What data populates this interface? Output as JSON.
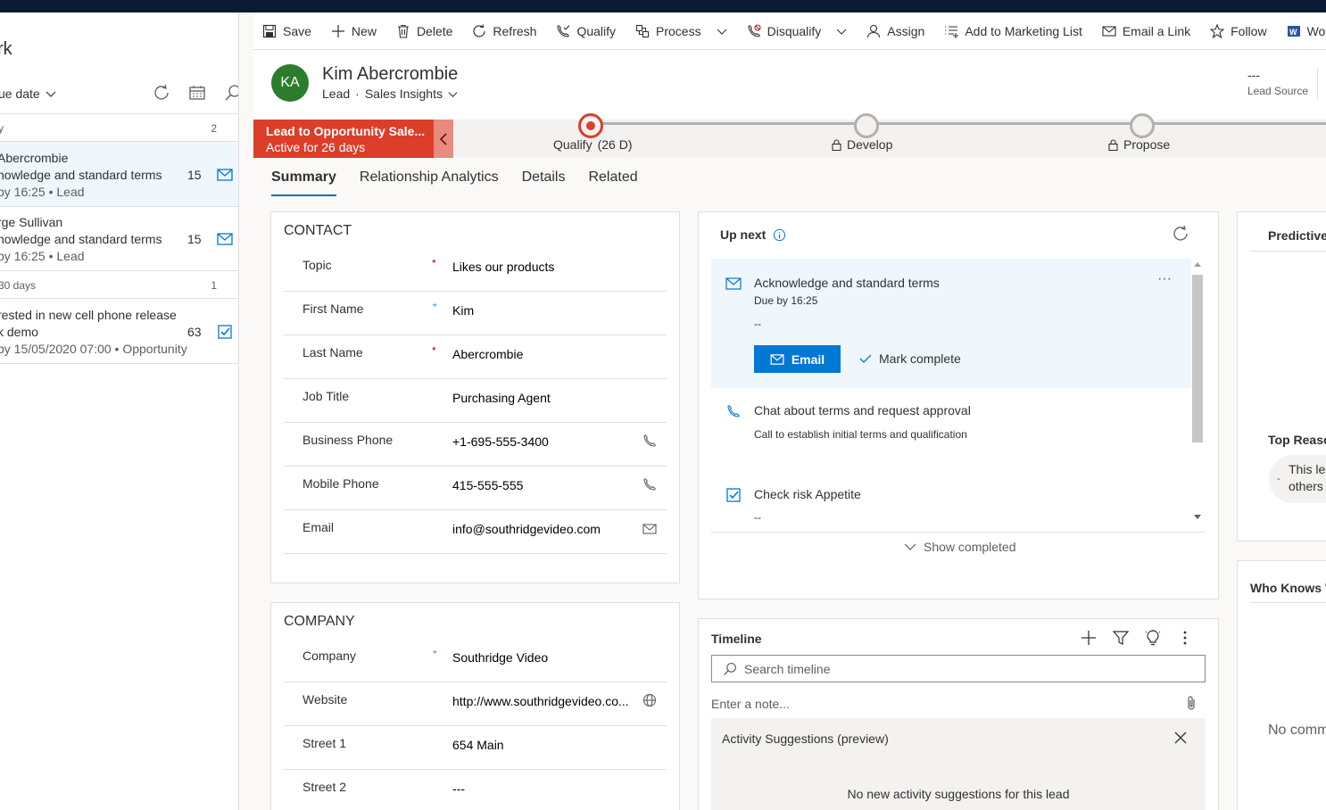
{
  "worklist": {
    "title": "rk",
    "sort_label": "ue date",
    "groups": [
      {
        "label": "y",
        "count": "2"
      },
      {
        "label": "30 days",
        "count": "1"
      }
    ],
    "items": [
      {
        "line1": "Abercrombie",
        "line2": "nowledge and standard terms",
        "line3": "by 16:25 • Lead",
        "count": "15",
        "icon": "mail-icon"
      },
      {
        "line1": "rge Sullivan",
        "line2": "nowledge and standard terms",
        "line3": "by 16:25 • Lead",
        "count": "15",
        "icon": "mail-icon"
      },
      {
        "line1": "rested in new cell phone release",
        "line2": "k demo",
        "line3": "by 15/05/2020 07:00 • Opportunity",
        "count": "63",
        "icon": "task-check-icon"
      }
    ]
  },
  "commands": [
    {
      "label": "Save",
      "icon": "save-icon"
    },
    {
      "label": "New",
      "icon": "plus-icon"
    },
    {
      "label": "Delete",
      "icon": "trash-icon"
    },
    {
      "label": "Refresh",
      "icon": "refresh-icon"
    },
    {
      "label": "Qualify",
      "icon": "phone-check-icon"
    },
    {
      "label": "Process",
      "icon": "process-icon"
    },
    {
      "label": "Disqualify",
      "icon": "disqualify-icon"
    },
    {
      "label": "Assign",
      "icon": "person-icon"
    },
    {
      "label": "Add to Marketing List",
      "icon": "list-add-icon"
    },
    {
      "label": "Email a Link",
      "icon": "email-link-icon"
    },
    {
      "label": "Follow",
      "icon": "star-icon"
    },
    {
      "label": "Wo",
      "icon": "word-icon"
    }
  ],
  "record": {
    "initials": "KA",
    "name": "Kim Abercrombie",
    "entity": "Lead",
    "dot": "·",
    "form": "Sales Insights",
    "lead_source_value": "---",
    "lead_source_label": "Lead Source",
    "avatar_color": "#2b7d2b"
  },
  "process": {
    "name": "Lead to Opportunity Sale...",
    "active": "Active for 26 days",
    "stages": [
      {
        "label": "Qualify",
        "duration": "(26 D)"
      },
      {
        "label": "Develop"
      },
      {
        "label": "Propose"
      }
    ],
    "accent": "#dc3e2a"
  },
  "tabs": [
    "Summary",
    "Relationship Analytics",
    "Details",
    "Related"
  ],
  "contact": {
    "heading": "CONTACT",
    "fields": [
      {
        "label": "Topic",
        "req": "*",
        "value": "Likes our products"
      },
      {
        "label": "First Name",
        "req": "⁺",
        "value": "Kim"
      },
      {
        "label": "Last Name",
        "req": "*",
        "value": "Abercrombie"
      },
      {
        "label": "Job Title",
        "req": "",
        "value": "Purchasing Agent"
      },
      {
        "label": "Business Phone",
        "req": "",
        "value": "+1-695-555-3400"
      },
      {
        "label": "Mobile Phone",
        "req": "",
        "value": "415-555-555"
      },
      {
        "label": "Email",
        "req": "",
        "value": "info@southridgevideo.com"
      }
    ]
  },
  "company": {
    "heading": "COMPANY",
    "fields": [
      {
        "label": "Company",
        "req": "⁺",
        "value": "Southridge Video"
      },
      {
        "label": "Website",
        "req": "",
        "value": "http://www.southridgevideo.co..."
      },
      {
        "label": "Street 1",
        "req": "",
        "value": "654 Main"
      },
      {
        "label": "Street 2",
        "req": "",
        "value": "---"
      }
    ]
  },
  "upnext": {
    "title": "Up next",
    "more": "···",
    "activities": [
      {
        "title": "Acknowledge and standard terms",
        "sub": "Due by 16:25",
        "desc": "--"
      },
      {
        "title": "Chat about terms and request approval",
        "sub": "Call to establish initial terms and qualification"
      },
      {
        "title": "Check risk Appetite",
        "sub": "--"
      }
    ],
    "email_button": "Email",
    "complete_button": "Mark complete",
    "show_completed": "Show completed"
  },
  "timeline": {
    "title": "Timeline",
    "search_placeholder": "Search timeline",
    "note_placeholder": "Enter a note...",
    "suggestions_title": "Activity Suggestions (preview)",
    "suggestions_empty": "No new activity suggestions for this lead"
  },
  "predictive": {
    "title": "Predictive",
    "top_reasons": "Top Reaso",
    "reason_dash": "-",
    "reason_line1": "This lea",
    "reason_line2": "others"
  },
  "whoknows": {
    "title": "Who Knows W",
    "empty": "No comm"
  }
}
